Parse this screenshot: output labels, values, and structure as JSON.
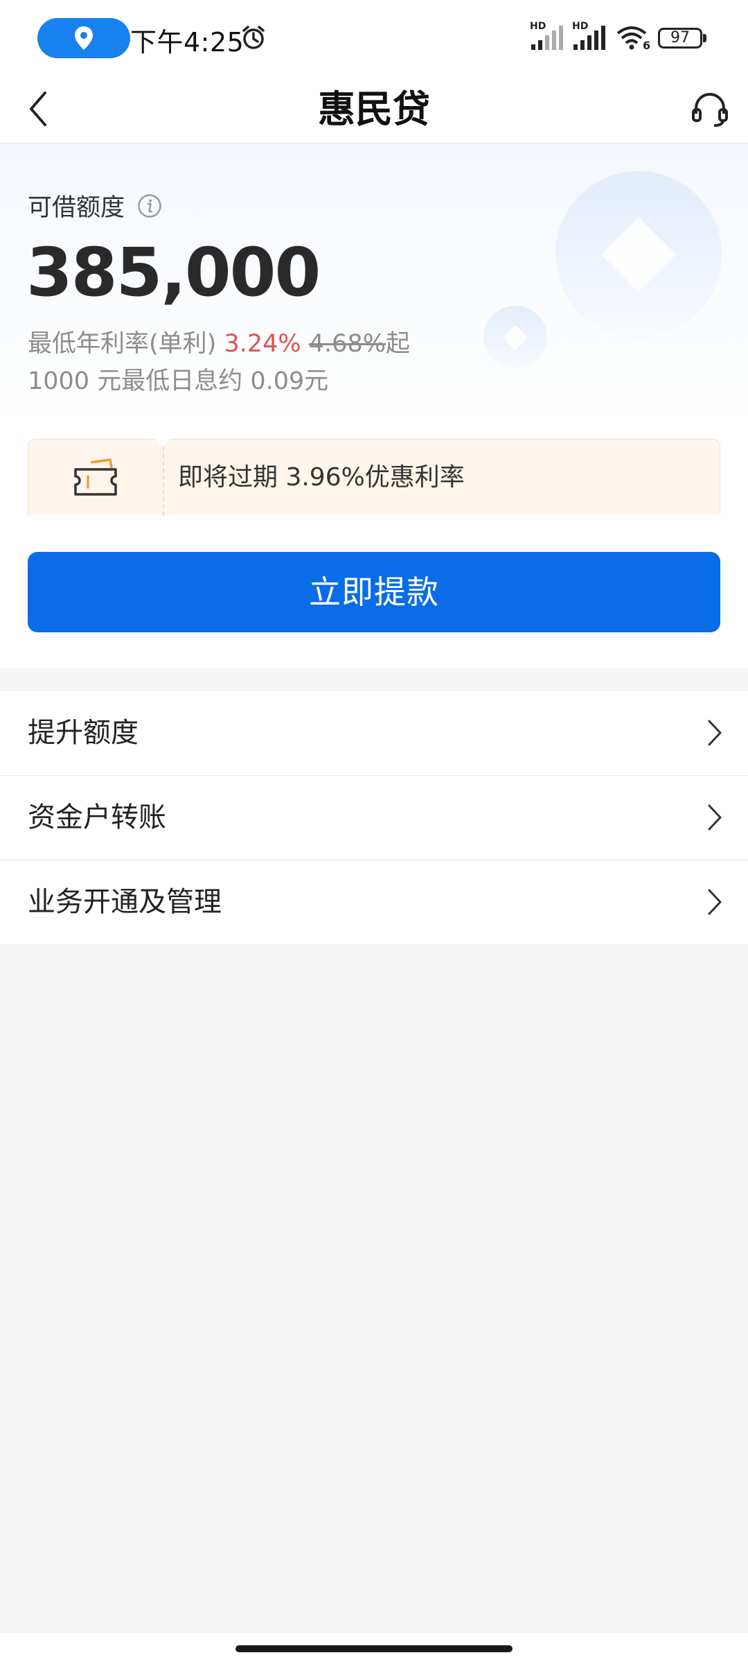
{
  "status_bar": {
    "time": "下午4:25",
    "battery": "97",
    "signal_tag_1": "HD",
    "signal_tag_2": "HD",
    "wifi_tag": "6"
  },
  "nav": {
    "title": "惠民贷"
  },
  "credit": {
    "label": "可借额度",
    "amount": "385,000",
    "rate_prefix": "最低年利率(单利)",
    "rate_current": "3.24%",
    "rate_original": "4.68%",
    "rate_suffix": "起",
    "daily_interest": "1000 元最低日息约 0.09元"
  },
  "promo": {
    "text": "即将过期 3.96%优惠利率"
  },
  "withdraw_button": "立即提款",
  "menu": [
    {
      "label": "提升额度"
    },
    {
      "label": "资金户转账"
    },
    {
      "label": "业务开通及管理"
    }
  ],
  "colors": {
    "primary": "#0a6ce6",
    "rate_highlight": "#e05050",
    "promo_bg": "#fef5ec",
    "page_bg": "#f5f5f5"
  },
  "icons": {
    "location": "location-pin-icon",
    "alarm": "alarm-clock-icon",
    "back": "chevron-left-icon",
    "service": "headset-icon",
    "info": "info-icon",
    "coupon": "coupon-ticket-icon",
    "chevron": "chevron-right-icon"
  }
}
